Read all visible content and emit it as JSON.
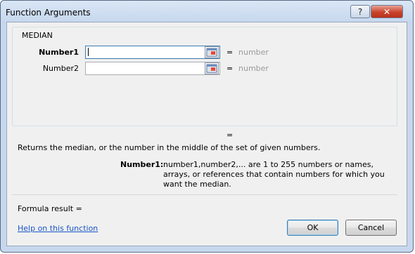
{
  "window": {
    "title": "Function Arguments",
    "help_glyph": "?",
    "close_glyph": "✕"
  },
  "function": {
    "name": "MEDIAN",
    "arguments": [
      {
        "label": "Number1",
        "value": "",
        "equals": "=",
        "result": "number"
      },
      {
        "label": "Number2",
        "value": "",
        "equals": "=",
        "result": "number"
      }
    ],
    "overall_equals": "=",
    "description": "Returns the median, or the number in the middle of the set of given numbers.",
    "arg_help_label": "Number1:",
    "arg_help_text": "number1,number2,... are 1 to 255 numbers or names, arrays, or references that contain numbers for which you want the median."
  },
  "footer": {
    "formula_result": "Formula result =",
    "help_link": "Help on this function",
    "ok_label": "OK",
    "cancel_label": "Cancel"
  },
  "icons": {
    "collapse_dialog": "collapse-dialog-icon"
  },
  "colors": {
    "link": "#1a55c4",
    "close_button": "#c9432c",
    "placeholder_value": "#9a9a9a"
  }
}
